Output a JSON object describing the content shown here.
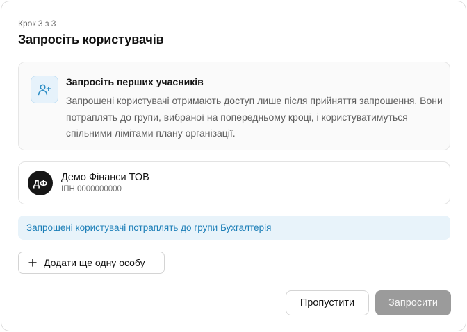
{
  "dialog": {
    "step": "Крок 3 з 3",
    "title": "Запросіть користувачів"
  },
  "info": {
    "icon": "user-plus-icon",
    "title": "Запросіть перших учасників",
    "text": "Запрошені користувачі отримають доступ лише після прийняття запрошення. Вони потраплять до групи, вибраної на попередньому кроці, і користуватимуться спільними лімітами плану організації."
  },
  "organization": {
    "initials": "ДФ",
    "name": "Демо Фінанси ТОВ",
    "tax_id": "ІПН 0000000000"
  },
  "group_notice": "Запрошені користувачі потраплять до групи Бухгалтерія",
  "actions": {
    "add_person": "Додати ще одну особу",
    "skip": "Пропустити",
    "invite": "Запросити"
  },
  "colors": {
    "accent": "#1d7fb8",
    "banner_bg": "#e8f3fa",
    "disabled_button": "#9b9b9b"
  }
}
